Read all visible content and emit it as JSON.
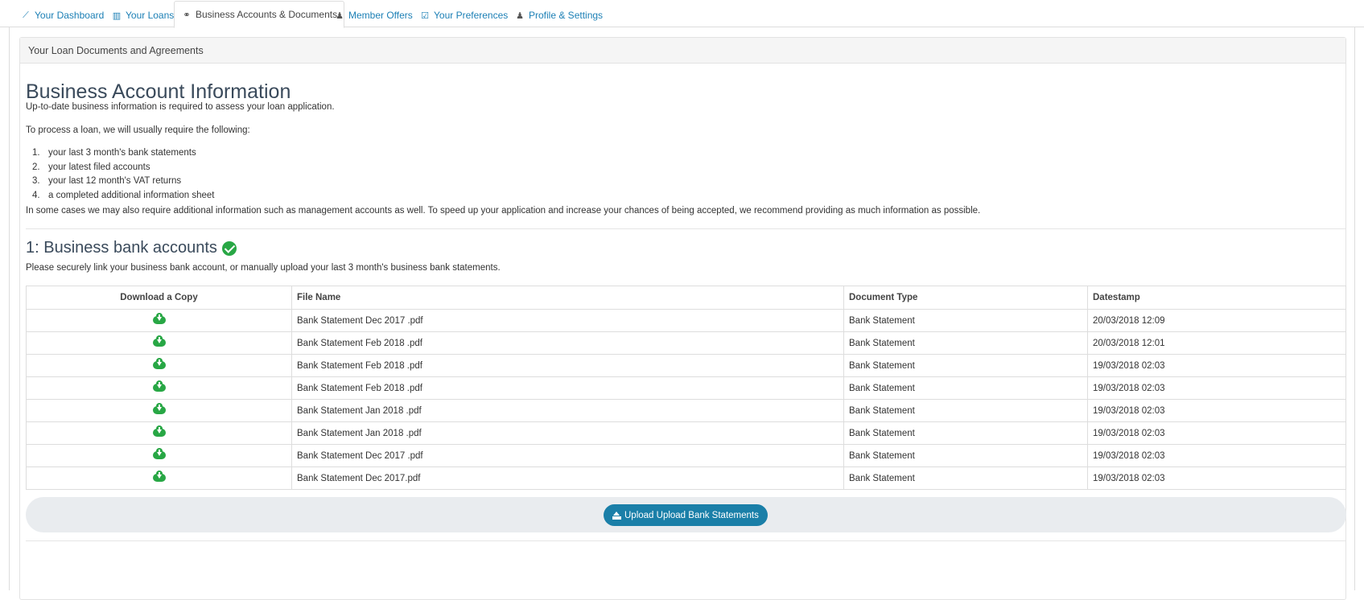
{
  "tabs": [
    {
      "label": "Your Dashboard",
      "icon": "line-chart-icon",
      "glyph": "📈"
    },
    {
      "label": "Your Loans",
      "icon": "building-icon",
      "glyph": "▥"
    },
    {
      "label": "Business Accounts & Documents",
      "icon": "link-icon",
      "glyph": "🔗"
    },
    {
      "label": "Member Offers",
      "icon": "user-icon",
      "glyph": "👤"
    },
    {
      "label": "Your Preferences",
      "icon": "check-square-icon",
      "glyph": "☑"
    },
    {
      "label": "Profile & Settings",
      "icon": "user-icon",
      "glyph": "👤"
    }
  ],
  "active_tab_index": 2,
  "panel": {
    "heading": "Your Loan Documents and Agreements"
  },
  "info": {
    "title": "Business Account Information",
    "intro": "Up-to-date business information is required to assess your loan application.",
    "process": "To process a loan, we will usually require the following:",
    "requirements": [
      {
        "num": "1.",
        "text": "your last 3 month's bank statements"
      },
      {
        "num": "2.",
        "text": "your latest filed accounts"
      },
      {
        "num": "3.",
        "text": "your last 12 month's VAT returns"
      },
      {
        "num": "4.",
        "text": "a completed additional information sheet"
      }
    ],
    "note": "In some cases we may also require additional information such as management accounts as well. To speed up your application and increase your chances of being accepted, we recommend providing as much information as possible."
  },
  "bank_section": {
    "title": "1: Business bank accounts",
    "status_icon": "check-circle-icon",
    "status_color": "#28a745",
    "description": "Please securely link your business bank account, or manually upload your last 3 month's business bank statements.",
    "columns": [
      "Download a Copy",
      "File Name",
      "Document Type",
      "Datestamp"
    ],
    "rows": [
      {
        "file": "Bank Statement Dec 2017 .pdf",
        "type": "Bank Statement",
        "date": "20/03/2018 12:09"
      },
      {
        "file": "Bank Statement Feb 2018 .pdf",
        "type": "Bank Statement",
        "date": "20/03/2018 12:01"
      },
      {
        "file": "Bank Statement Feb 2018 .pdf",
        "type": "Bank Statement",
        "date": "19/03/2018 02:03"
      },
      {
        "file": "Bank Statement Feb 2018 .pdf",
        "type": "Bank Statement",
        "date": "19/03/2018 02:03"
      },
      {
        "file": "Bank Statement Jan 2018  .pdf",
        "type": "Bank Statement",
        "date": "19/03/2018 02:03"
      },
      {
        "file": "Bank Statement Jan 2018  .pdf",
        "type": "Bank Statement",
        "date": "19/03/2018 02:03"
      },
      {
        "file": "Bank Statement Dec 2017 .pdf",
        "type": "Bank Statement",
        "date": "19/03/2018 02:03"
      },
      {
        "file": "Bank Statement Dec 2017.pdf",
        "type": "Bank Statement",
        "date": "19/03/2018 02:03"
      }
    ],
    "download_icon": "cloud-download-icon",
    "upload_button": "Upload Upload Bank Statements",
    "upload_icon": "upload-icon",
    "accent_color": "#1a7fa8"
  }
}
